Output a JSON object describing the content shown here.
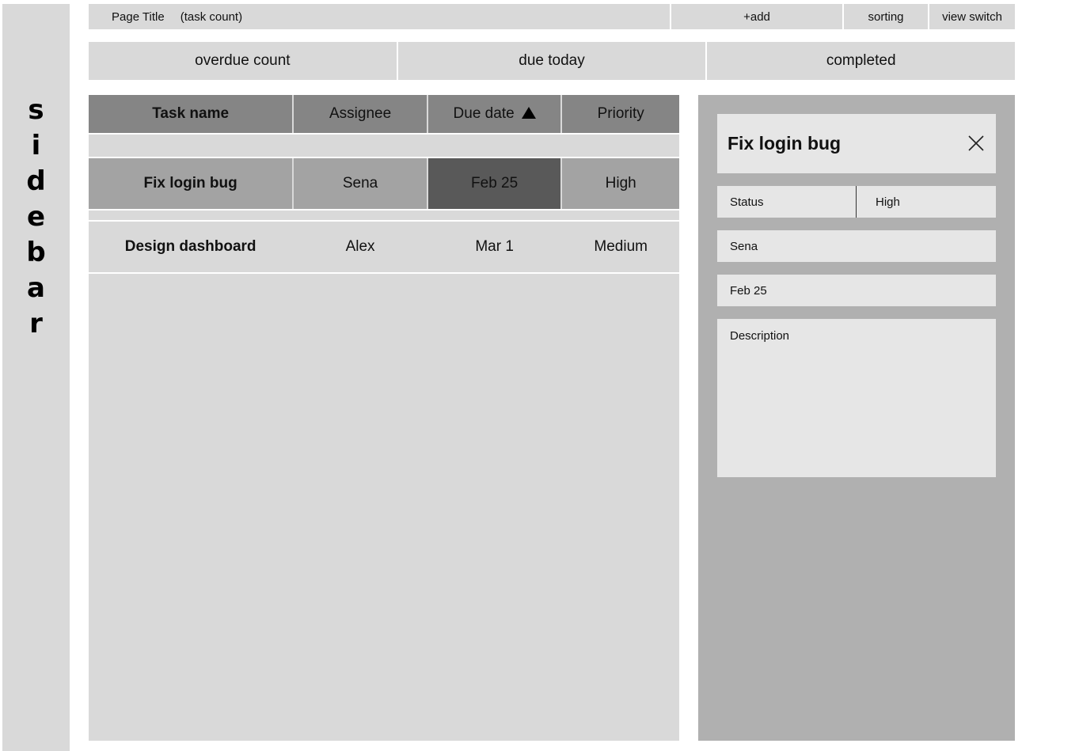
{
  "sidebar": {
    "label": "sidebar"
  },
  "topbar": {
    "page_title": "Page Title",
    "task_count": "(task count)",
    "add_label": "+add",
    "sorting_label": "sorting",
    "view_switch_label": "view switch"
  },
  "summary": {
    "overdue": "overdue count",
    "due_today": "due today",
    "completed": "completed"
  },
  "table": {
    "columns": [
      "Task name",
      "Assignee",
      "Due date",
      "Priority"
    ],
    "rows": [
      {
        "task": "Fix login bug",
        "assignee": "Sena",
        "due": "Feb 25",
        "priority": "High"
      },
      {
        "task": "Design dashboard",
        "assignee": "Alex",
        "due": "Mar 1",
        "priority": "Medium"
      }
    ]
  },
  "detail": {
    "title": "Fix login bug",
    "status_label": "Status",
    "status_value": "High",
    "assignee": "Sena",
    "due": "Feb 25",
    "description_placeholder": "Description"
  }
}
